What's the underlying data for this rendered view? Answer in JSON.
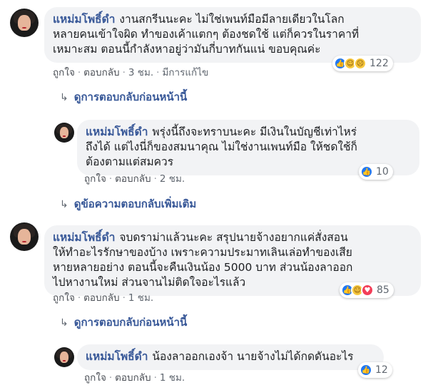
{
  "comments": [
    {
      "author": "แหม่มโพธิ์ดำ",
      "lines": [
        "งานสกรีนนะคะ ไม่ใช่เพนท์มือมีลายเดียวในโลก",
        "หลายคนเข้าใจผิด ทำของเค้าแตกๆ ต้องชดใช้ แต่ก็ควรในราคาที่",
        "เหมาะสม ตอนนี้กำลังหาอยู่ว่ามันกี่บาทกันแน่ ขอบคุณค่ะ"
      ],
      "like": "ถูกใจ",
      "reply": "ตอบกลับ",
      "time": "3 ชม.",
      "edited": "มีการแก้ไข",
      "reaction_count": "122"
    },
    {
      "author": "แหม่มโพธิ์ดำ",
      "lines": [
        "พรุ่งนี้ถึงจะทราบนะคะ มีเงินในบัญชีเท่าไหร่",
        "ถึงได้ แต่ไงนี่ก็ของสมนาคุณ ไม่ใช่งานเพนท์มือ ให้ชดใช้ก็",
        "ต้องตามแต่สมควร"
      ],
      "like": "ถูกใจ",
      "reply": "ตอบกลับ",
      "time": "2 ชม.",
      "reaction_count": "10"
    },
    {
      "author": "แหม่มโพธิ์ดำ",
      "lines": [
        "จบดราม่าแล้วนะคะ สรุปนายจ้างอยากแค่สั่งสอน",
        "ให้ทำอะไรรักษาของบ้าง เพราะความประมาทเลินเล่อทำของเสีย",
        "หายหลายอย่าง ตอนนี้จะคืนเงินน้อง 5000 บาท ส่วนน้องลาออก",
        "ไปหางานใหม่ ส่วนจานไม่ติดใจอะไรแล้ว"
      ],
      "like": "ถูกใจ",
      "reply": "ตอบกลับ",
      "time": "1 ชม.",
      "reaction_count": "85"
    },
    {
      "author": "แหม่มโพธิ์ดำ",
      "lines": [
        "น้องลาออกเองจ้า นายจ้างไม่ได้กดดันอะไร"
      ],
      "like": "ถูกใจ",
      "reply": "ตอบกลับ",
      "time": "1 ชม.",
      "reaction_count": "12"
    }
  ],
  "links": {
    "previous_replies_1": "ดูการตอบกลับก่อนหน้านี้",
    "more_replies": "ดูข้อความตอบกลับเพิ่มเติม",
    "previous_replies_2": "ดูการตอบกลับก่อนหน้านี้"
  },
  "separator": "·",
  "icons": {
    "reply_arrow": "reply-arrow-icon",
    "like": "like-reaction-icon",
    "haha": "haha-reaction-icon",
    "sad": "sad-reaction-icon",
    "love": "love-reaction-icon"
  },
  "colors": {
    "name": "#385898",
    "bubble": "#f2f3f5",
    "like_blue": "#2078f4",
    "love_red": "#f33e58"
  }
}
